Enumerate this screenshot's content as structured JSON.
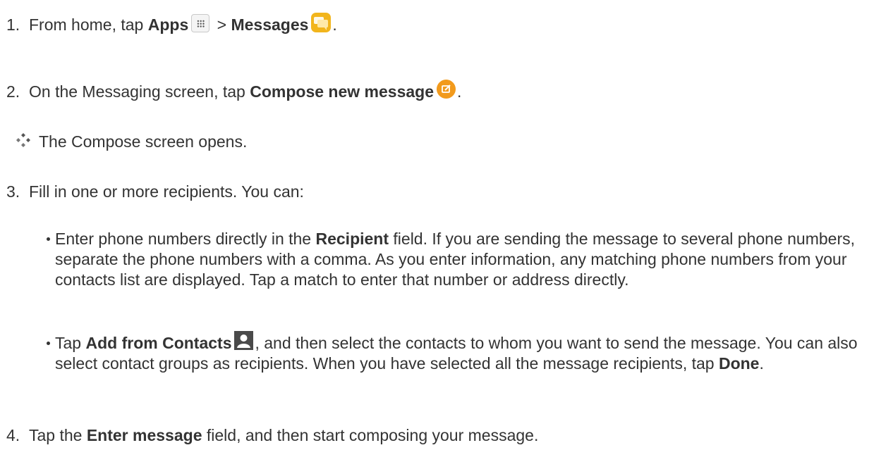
{
  "steps": [
    {
      "num": "1.",
      "pre": "From home, tap ",
      "b1": "Apps",
      "mid": " > ",
      "b2": "Messages",
      "post": "."
    },
    {
      "num": "2.",
      "pre": "On the Messaging screen, tap ",
      "b1": "Compose new message",
      "post": "."
    },
    {
      "result": "The Compose screen opens."
    },
    {
      "num": "3.",
      "text": "Fill in one or more recipients. You can:"
    },
    {
      "num": "4.",
      "pre": "Tap the ",
      "b1": "Enter message",
      "post": " field, and then start composing your message."
    }
  ],
  "bullets": [
    {
      "pre": "Enter phone numbers directly in the ",
      "b1": "Recipient",
      "post": " field. If you are sending the message to several phone numbers, separate the phone numbers with a comma. As you enter information, any matching phone numbers from your contacts list are displayed. Tap a match to enter that number or address directly."
    },
    {
      "pre": "Tap ",
      "b1": "Add from Contacts",
      "mid": ", and then select the contacts to whom you want to send the message. You can also select contact groups as recipients. When you have selected all the message recipients, tap ",
      "b2": "Done",
      "post": "."
    }
  ],
  "icons": {
    "apps": "apps-grid-icon",
    "messages": "messages-app-icon",
    "compose": "compose-new-message-icon",
    "contacts": "add-contact-icon",
    "result": "result-diamond-icon"
  },
  "colors": {
    "text": "#333333",
    "messages_icon": "#f2b51c",
    "compose_icon": "#f29a1c",
    "contact_icon": "#4a4a4a"
  }
}
